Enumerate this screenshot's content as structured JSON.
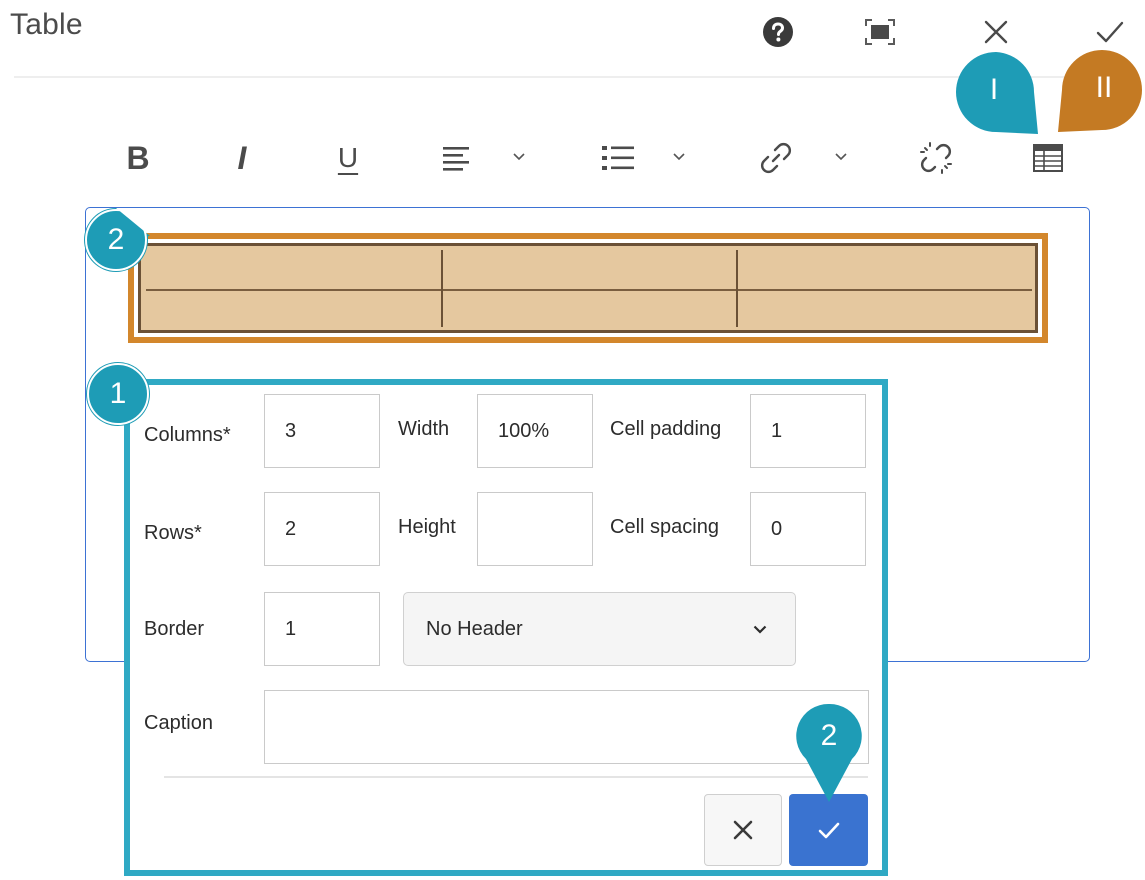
{
  "header": {
    "title": "Table",
    "help_icon": "help-circle-icon",
    "fullscreen_icon": "fullscreen-icon",
    "close_icon": "close-icon",
    "done_icon": "checkmark-icon"
  },
  "toolbar": {
    "bold_label": "B",
    "italic_label": "I",
    "underline_label": "U",
    "items": [
      "bold",
      "italic",
      "underline",
      "align",
      "list",
      "link",
      "unlink",
      "table"
    ]
  },
  "editor_table": {
    "rows": 2,
    "columns": 3
  },
  "dialog": {
    "columns_label": "Columns*",
    "columns_value": "3",
    "width_label": "Width",
    "width_value": "100%",
    "cell_padding_label": "Cell padding",
    "cell_padding_value": "1",
    "rows_label": "Rows*",
    "rows_value": "2",
    "height_label": "Height",
    "height_value": "",
    "cell_spacing_label": "Cell spacing",
    "cell_spacing_value": "0",
    "border_label": "Border",
    "border_value": "1",
    "header_select_value": "No Header",
    "caption_label": "Caption",
    "caption_value": ""
  },
  "callouts": {
    "roman_one": "I",
    "roman_two": "II",
    "table_marker": "2",
    "dialog_marker": "1",
    "ok_marker": "2"
  },
  "colors": {
    "teal_callout": "#1e9cb6",
    "orange_callout": "#c47a23",
    "dialog_frame": "#2fa9c4",
    "table_frame": "#d3872c",
    "ok_button": "#3a73d0",
    "editor_border": "#3d72d4"
  }
}
